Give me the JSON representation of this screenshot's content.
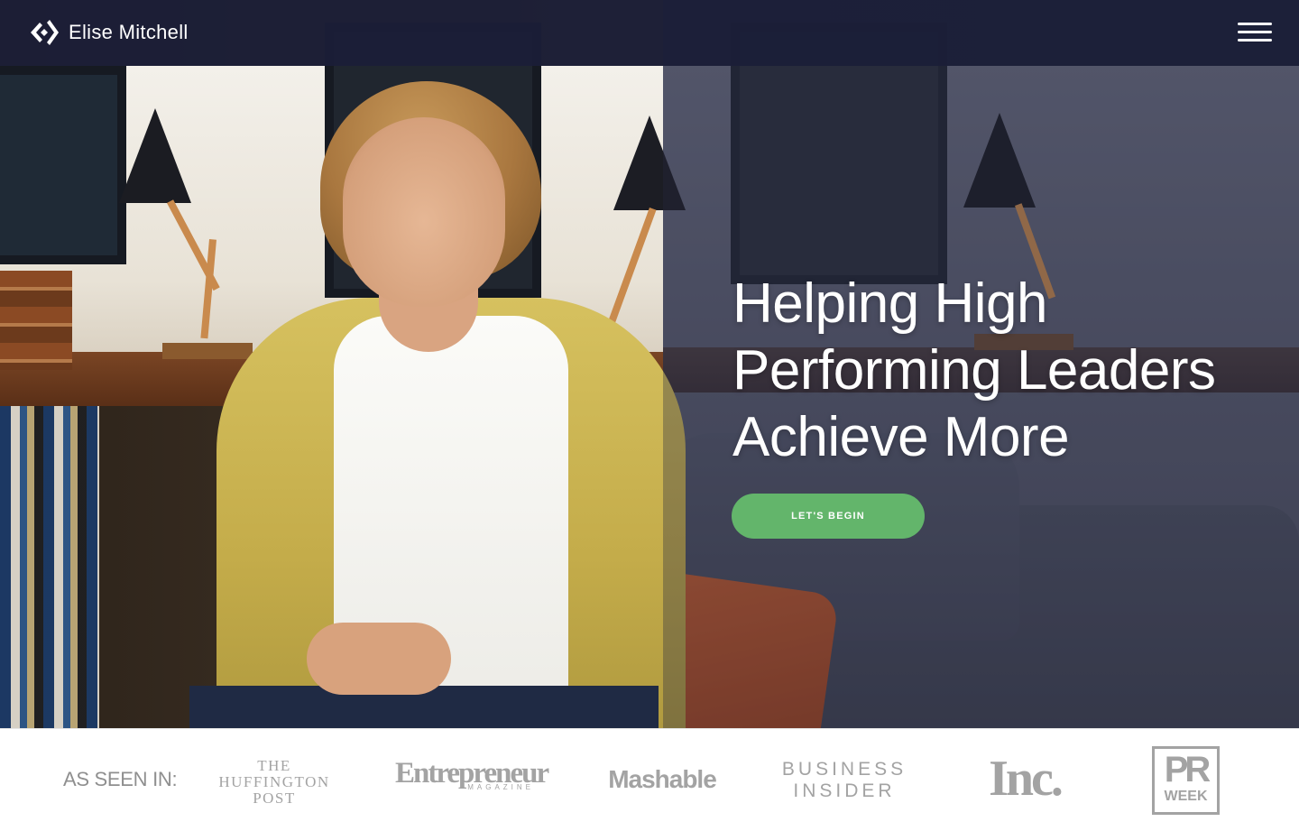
{
  "header": {
    "brand_name": "Elise Mitchell",
    "logo_icon": "diamond-chevrons-logo",
    "menu_icon": "hamburger-menu-icon"
  },
  "hero": {
    "headline_lines": [
      "Helping High",
      "Performing Leaders",
      "Achieve More"
    ],
    "cta_label": "LET'S BEGIN",
    "cta_color": "#63b56b",
    "photo_description": "portrait-photo"
  },
  "press": {
    "label": "AS SEEN IN:",
    "logos": {
      "huffington": [
        "THE",
        "HUFFINGTON",
        "POST"
      ],
      "entrepreneur": "Entrepreneur",
      "entrepreneur_sub": "MAGAZINE",
      "mashable": "Mashable",
      "business_insider": [
        "BUSINESS",
        "INSIDER"
      ],
      "inc": "Inc.",
      "prweek_top": "PR",
      "prweek_bottom": "WEEK"
    }
  },
  "colors": {
    "header_bg": "#1b1e38",
    "accent_green": "#63b56b",
    "logo_gray": "#a3a3a3"
  }
}
